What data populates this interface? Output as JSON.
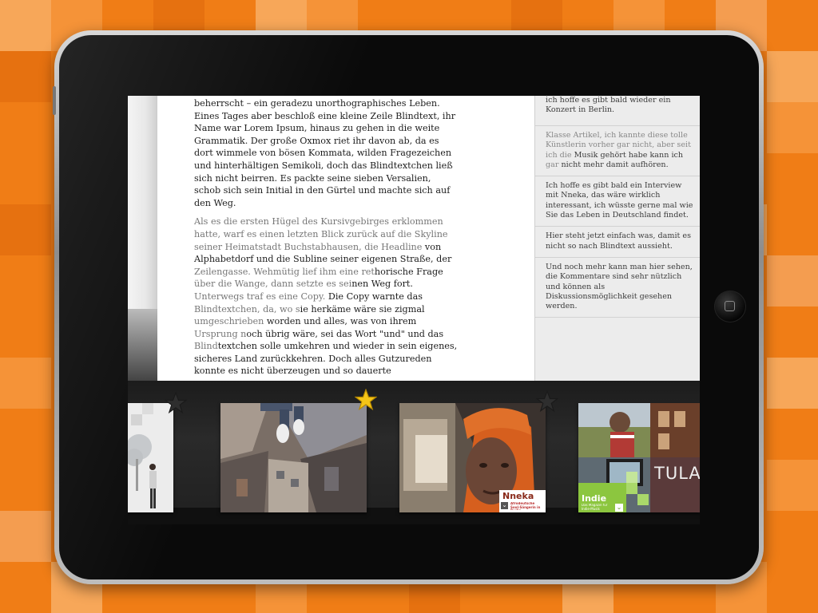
{
  "article": {
    "paragraph1": [
      {
        "t": "beherrscht – ein geradezu unorthographisches Leben. Eines Tages aber beschloß eine kleine Zeile Blindtext, ihr Name war Lorem Ipsum, hinaus zu gehen in die weite Grammatik. Der große Oxmox riet ihr davon ab, da es dort wimmele von bösen Kommata, wilden Fragezeichen und hinterhältigen Semikoli, doch das Blindtextchen ließ sich nicht beirren. Es packte seine sieben Versalien, schob sich sein Initial in den Gürtel und machte sich auf den Weg.",
        "style": "normal"
      }
    ],
    "paragraph2": [
      {
        "t": "Als es die ersten Hügel des Kursivgebirges erklommen hatte, warf es einen letzten Blick zurück auf die Skyline seiner Heimatstadt Buchstabhausen, die Headline ",
        "style": "gray"
      },
      {
        "t": "von Alphabetdorf und die Subline seiner eigenen ",
        "style": "normal"
      },
      {
        "t": "Straße, der ",
        "style": "normal"
      },
      {
        "t": "Zeilengasse. Wehmütig lief ihm eine ret",
        "style": "gray"
      },
      {
        "t": "horische Frage ",
        "style": "normal"
      },
      {
        "t": "über die Wange, dann setzte es sei",
        "style": "gray"
      },
      {
        "t": "nen Weg fort. ",
        "style": "normal"
      },
      {
        "t": "Unterwegs traf es eine Copy. ",
        "style": "gray"
      },
      {
        "t": "Die Copy warnte das ",
        "style": "normal"
      },
      {
        "t": "Blindtextchen, da, wo s",
        "style": "gray"
      },
      {
        "t": "ie herkäme wäre sie zigmal ",
        "style": "normal"
      },
      {
        "t": "umgeschrieben ",
        "style": "gray"
      },
      {
        "t": "worden und alles, was von ihrem ",
        "style": "normal"
      },
      {
        "t": "Ursprung n",
        "style": "gray"
      },
      {
        "t": "och übrig wäre, sei das Wort \"und\" und das ",
        "style": "normal"
      },
      {
        "t": "Blind",
        "style": "gray"
      },
      {
        "t": "textchen solle umkehren und wieder in sein eigenes, sicheres Land zurückkehren. Doch alles Gutzureden konnte es nicht überzeugen und so dauerte",
        "style": "normal"
      }
    ]
  },
  "comments": [
    {
      "parts": [
        {
          "t": "ich hoffe es gibt bald wieder ein Konzert in Berlin.",
          "style": "normal"
        }
      ]
    },
    {
      "parts": [
        {
          "t": "Klasse Artikel, ich kannte diese tolle Künstlerin vorher gar nicht, aber seit ich die ",
          "style": "gray"
        },
        {
          "t": "Musik gehört habe kann ich ",
          "style": "normal"
        },
        {
          "t": "gar ",
          "style": "gray"
        },
        {
          "t": "nicht mehr damit aufhören.",
          "style": "normal"
        }
      ]
    },
    {
      "parts": [
        {
          "t": "Ich hoffe es gibt bald ein Interview mit Nneka, das wäre wirklich interessant, ich wüsste gerne mal wie Sie das Leben in Deutschland findet.",
          "style": "normal"
        }
      ]
    },
    {
      "parts": [
        {
          "t": "Hier steht jetzt einfach was, damit es nicht so nach Blindtext aussieht.",
          "style": "normal"
        }
      ]
    },
    {
      "parts": [
        {
          "t": "Und noch mehr kann man hier sehen, die Kommentare sind sehr nützlich und können als Diskussionsmöglichkeit gesehen werden.",
          "style": "normal"
        }
      ]
    }
  ],
  "shelf": {
    "items": [
      {
        "id": "thumb-art",
        "favorite": false
      },
      {
        "id": "thumb-skyscraper",
        "favorite": true
      },
      {
        "id": "thumb-nneka",
        "favorite": false,
        "label": "Nneka",
        "sublabel": "Afrodeutsche Soul-Sängerin in Berlin"
      },
      {
        "id": "thumb-indie",
        "favorite": false,
        "label": "Indie",
        "sublabel": "Das Magazin für Indie-Musik",
        "overlay": "TULA"
      }
    ]
  },
  "colors": {
    "background": "#f07d16",
    "star_active": "#f5c518",
    "star_inactive": "#2e2e2e",
    "indie_green": "#8cc63f"
  }
}
